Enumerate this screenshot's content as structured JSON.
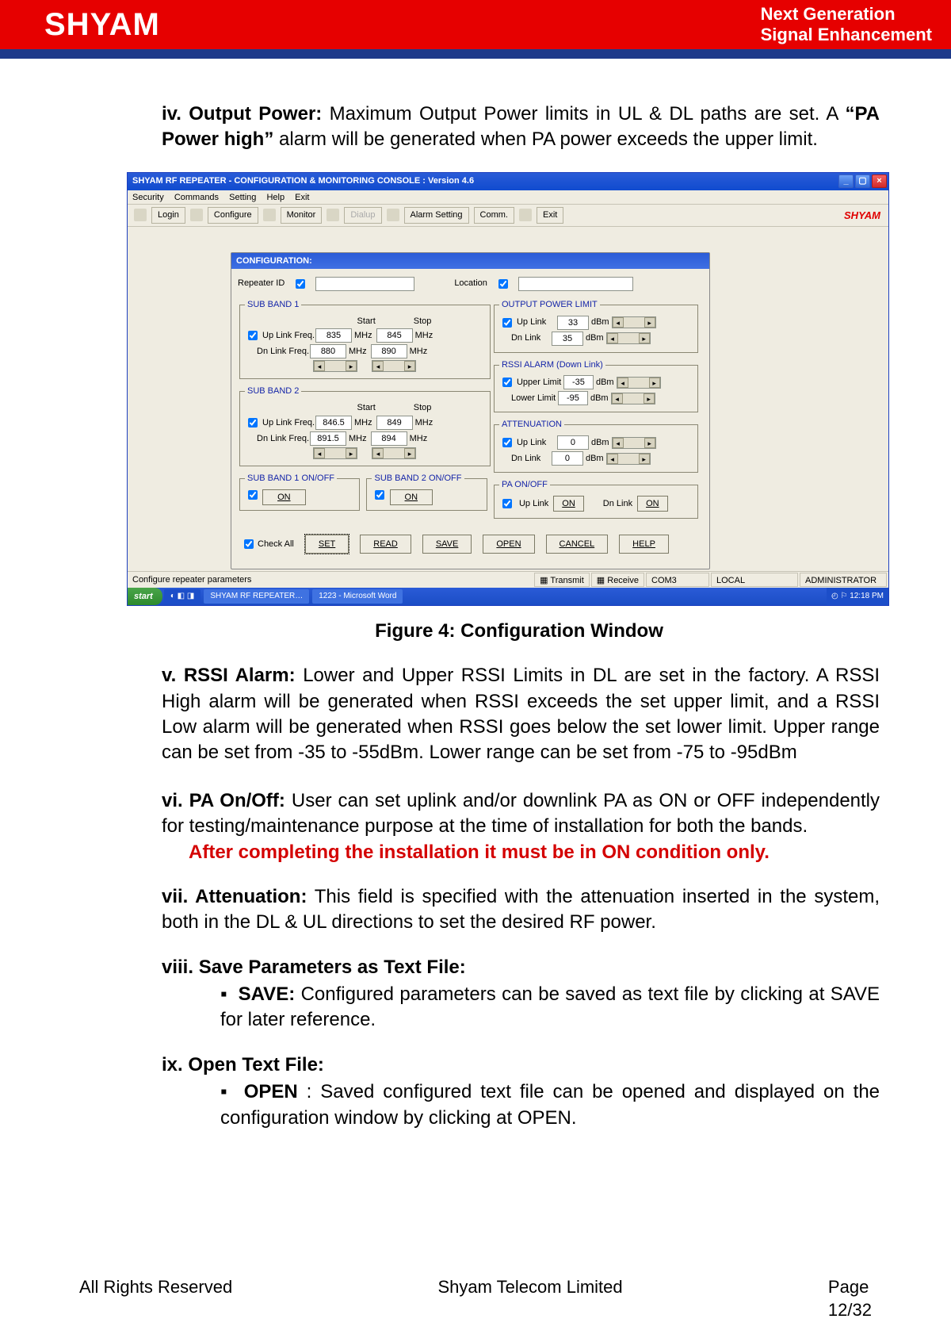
{
  "header": {
    "logo": "SHYAM",
    "tagline_line1": "Next Generation",
    "tagline_line2": "Signal Enhancement"
  },
  "section_iv": {
    "marker": "iv. Output Power:",
    "text": " Maximum Output Power limits in UL & DL paths are set. A ",
    "bold_mid": "“PA Power high”",
    "text2": " alarm will be generated when PA power exceeds the upper limit."
  },
  "figure_caption": "Figure 4: Configuration Window",
  "section_v": {
    "marker": "v.  RSSI Alarm:",
    "text": " Lower and Upper RSSI Limits in DL are set in the factory. A RSSI High alarm will be generated when RSSI exceeds the set upper limit, and a RSSI Low alarm will be generated when RSSI goes below the set lower limit. Upper range can be set from -35 to -55dBm. Lower range can be set from -75 to -95dBm"
  },
  "section_vi": {
    "marker": "vi. PA On/Off:",
    "text": " User can set uplink and/or downlink PA as ON or OFF independently for testing/maintenance purpose at the time of installation for both the bands.",
    "red": "After completing the installation it must be in ON condition only."
  },
  "section_vii": {
    "marker": "vii. Attenuation:",
    "text": " This field is specified with the attenuation inserted in the system, both in the DL & UL directions to set the desired RF power."
  },
  "section_viii": {
    "marker": "viii. Save Parameters as Text File:",
    "bullet_label": "SAVE:",
    "bullet_text": " Configured parameters can be saved as text file by clicking at SAVE for later reference."
  },
  "section_ix": {
    "marker": "ix.  Open Text File:",
    "bullet_label": "OPEN",
    "bullet_text": ": Saved configured text file can be opened and displayed on the configuration window by clicking at OPEN."
  },
  "footer": {
    "left": "All Rights Reserved",
    "center": "Shyam Telecom Limited",
    "right1": "Page",
    "right2": "12/32"
  },
  "shot": {
    "titlebar": "SHYAM RF REPEATER - CONFIGURATION & MONITORING CONSOLE  :  Version 4.6",
    "menubar": [
      "Security",
      "Commands",
      "Setting",
      "Help",
      "Exit"
    ],
    "toolbar": {
      "login": "Login",
      "configure": "Configure",
      "monitor": "Monitor",
      "dialup": "Dialup",
      "alarm_setting": "Alarm Setting",
      "comm": "Comm.",
      "exit": "Exit",
      "logo": "SHYAM"
    },
    "panel_title": "CONFIGURATION:",
    "repeater_id_label": "Repeater ID",
    "location_label": "Location",
    "sub_band_1": {
      "legend": "SUB BAND 1",
      "start": "Start",
      "stop": "Stop",
      "up_label": "Up Link Freq.",
      "dn_label": "Dn Link Freq.",
      "up_start": "835",
      "up_stop": "845",
      "dn_start": "880",
      "dn_stop": "890",
      "unit": "MHz"
    },
    "sub_band_2": {
      "legend": "SUB BAND 2",
      "start": "Start",
      "stop": "Stop",
      "up_label": "Up Link Freq.",
      "dn_label": "Dn Link Freq.",
      "up_start": "846.5",
      "up_stop": "849",
      "dn_start": "891.5",
      "dn_stop": "894",
      "unit": "MHz"
    },
    "output_power": {
      "legend": "OUTPUT POWER LIMIT",
      "up": "Up Link",
      "dn": "Dn Link",
      "up_val": "33",
      "dn_val": "35",
      "dbm": "dBm"
    },
    "rssi": {
      "legend": "RSSI ALARM (Down Link)",
      "upper": "Upper Limit",
      "lower": "Lower Limit",
      "upper_val": "-35",
      "lower_val": "-95",
      "dbm": "dBm"
    },
    "atten": {
      "legend": "ATTENUATION",
      "up": "Up Link",
      "dn": "Dn Link",
      "up_val": "0",
      "dn_val": "0",
      "dbm": "dBm"
    },
    "sb1_onoff": {
      "legend": "SUB BAND 1 ON/OFF",
      "btn": "ON"
    },
    "sb2_onoff": {
      "legend": "SUB BAND 2 ON/OFF",
      "btn": "ON"
    },
    "pa_onoff": {
      "legend": "PA ON/OFF",
      "up": "Up Link",
      "dn": "Dn Link",
      "up_btn": "ON",
      "dn_btn": "ON"
    },
    "check_all": "Check All",
    "buttons": {
      "set": "SET",
      "read": "READ",
      "save": "SAVE",
      "open": "OPEN",
      "cancel": "CANCEL",
      "help": "HELP"
    },
    "statusbar": {
      "left": "Configure repeater parameters",
      "transmit": "Transmit",
      "receive": "Receive",
      "com": "COM3",
      "mode": "LOCAL",
      "user": "ADMINISTRATOR"
    },
    "taskbar": {
      "start": "start",
      "tab1": "SHYAM RF REPEATER…",
      "tab2": "1223 - Microsoft Word",
      "clock": "12:18 PM"
    }
  }
}
